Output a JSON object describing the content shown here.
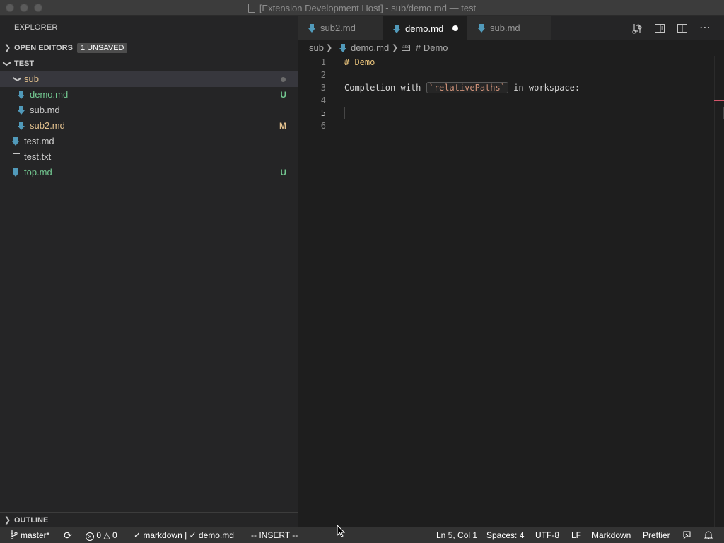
{
  "window": {
    "title": "[Extension Development Host] - sub/demo.md — test"
  },
  "sidebar": {
    "title": "EXPLORER",
    "open_editors": {
      "label": "OPEN EDITORS",
      "badge": "1 UNSAVED"
    },
    "workspace": {
      "label": "TEST"
    },
    "tree": [
      {
        "name": "sub",
        "type": "folder",
        "status": ""
      },
      {
        "name": "demo.md",
        "type": "md",
        "status": "U"
      },
      {
        "name": "sub.md",
        "type": "md",
        "status": ""
      },
      {
        "name": "sub2.md",
        "type": "md",
        "status": "M"
      },
      {
        "name": "test.md",
        "type": "md",
        "status": ""
      },
      {
        "name": "test.txt",
        "type": "txt",
        "status": ""
      },
      {
        "name": "top.md",
        "type": "md",
        "status": "U"
      }
    ],
    "outline": {
      "label": "OUTLINE"
    }
  },
  "tabs": [
    {
      "label": "sub2.md",
      "active": false
    },
    {
      "label": "demo.md",
      "active": true,
      "dirty": true
    },
    {
      "label": "sub.md",
      "active": false
    }
  ],
  "breadcrumbs": {
    "folder": "sub",
    "file": "demo.md",
    "symbol": "# Demo"
  },
  "editor": {
    "line_numbers": [
      "1",
      "2",
      "3",
      "4",
      "5",
      "6"
    ],
    "line1": "# Demo",
    "line3_before": "Completion with ",
    "line3_code": "`relativePaths`",
    "line3_after": " in workspace:"
  },
  "statusbar": {
    "branch": "master*",
    "errors": "0",
    "warnings": "0",
    "lint": "✓ markdown | ✓ demo.md",
    "mode": "-- INSERT --",
    "position": "Ln 5, Col 1",
    "spaces": "Spaces: 4",
    "encoding": "UTF-8",
    "eol": "LF",
    "language": "Markdown",
    "formatter": "Prettier"
  },
  "colors": {
    "accent": "#d4556a",
    "untracked": "#73c991",
    "modified": "#e2c08d",
    "md_icon": "#519aba"
  }
}
